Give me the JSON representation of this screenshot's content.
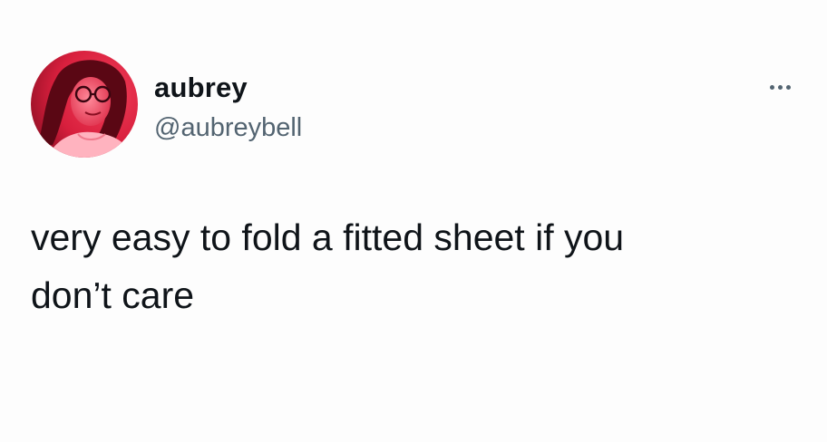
{
  "tweet": {
    "author": {
      "display_name": "aubrey",
      "handle": "@aubreybell",
      "avatar_icon": "profile-photo-avatar"
    },
    "more_icon": "more-options-icon",
    "text": "very easy to fold a fitted sheet if you\ndon’t care"
  },
  "colors": {
    "background": "#fdfdfd",
    "text_primary": "#0f1419",
    "text_secondary": "#536471",
    "avatar_tint": "#e3283f"
  }
}
